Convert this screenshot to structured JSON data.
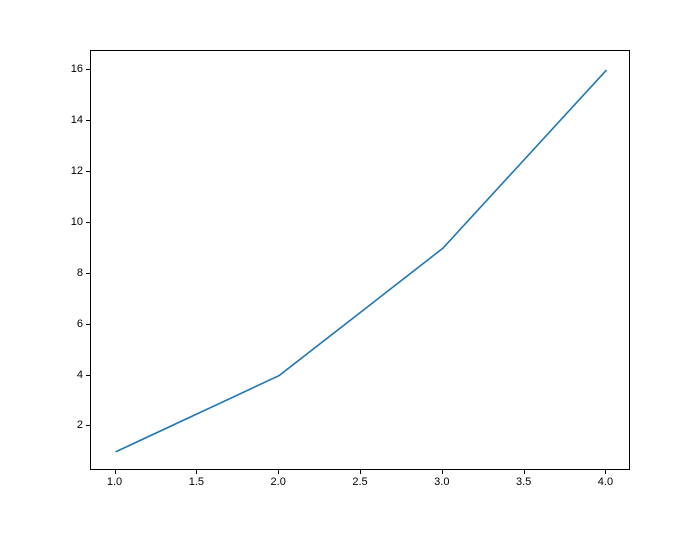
{
  "chart_data": {
    "type": "line",
    "x": [
      1,
      2,
      3,
      4
    ],
    "values": [
      1,
      4,
      9,
      16
    ],
    "title": "",
    "xlabel": "",
    "ylabel": "",
    "xlim": [
      0.85,
      4.15
    ],
    "ylim": [
      0.25,
      16.75
    ],
    "xticks": [
      1.0,
      1.5,
      2.0,
      2.5,
      3.0,
      3.5,
      4.0
    ],
    "yticks": [
      2,
      4,
      6,
      8,
      10,
      12,
      14,
      16
    ],
    "xtick_labels": [
      "1.0",
      "1.5",
      "2.0",
      "2.5",
      "3.0",
      "3.5",
      "4.0"
    ],
    "ytick_labels": [
      "2",
      "4",
      "6",
      "8",
      "10",
      "12",
      "14",
      "16"
    ],
    "line_color": "#1f77b4"
  }
}
